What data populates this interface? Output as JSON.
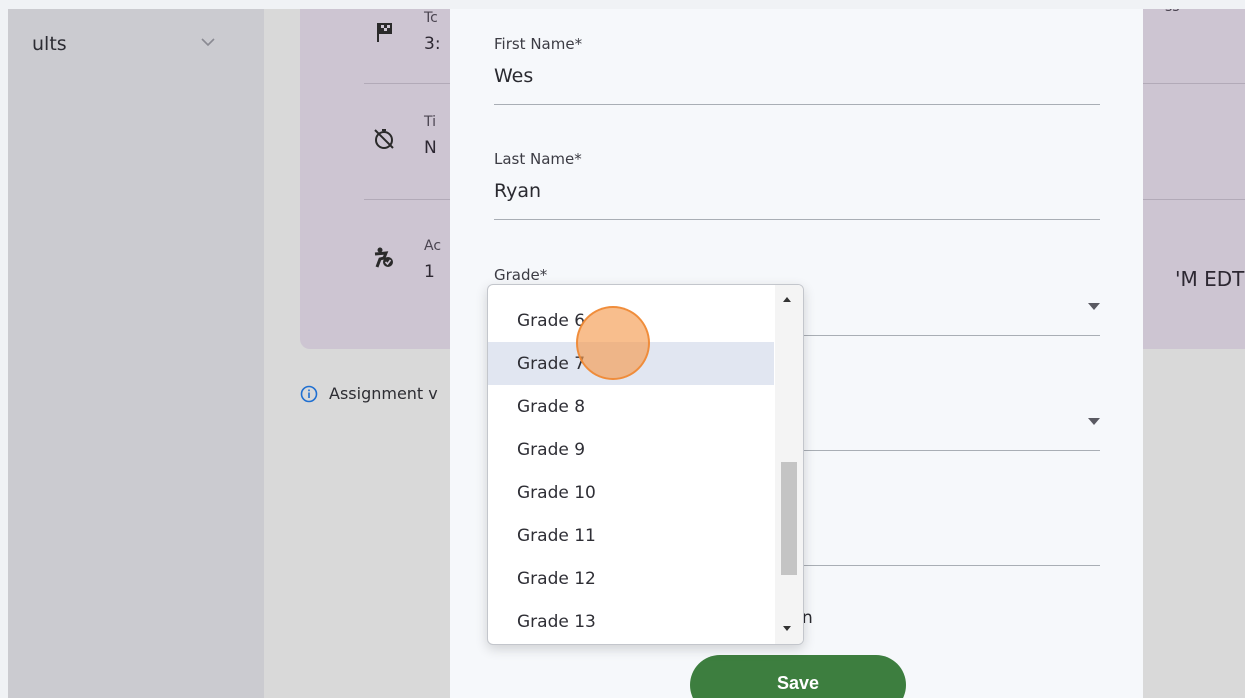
{
  "sidebar": {
    "item_label": "ults",
    "chevron_icon": "chevron-down-icon"
  },
  "background": {
    "rows": [
      {
        "icon": "checkered-flag-icon",
        "t1": "Tc",
        "t2": "3:"
      },
      {
        "icon": "timer-off-icon",
        "t1": "Ti",
        "t2": "N"
      },
      {
        "icon": "accessibility-icon",
        "t1": "Ac",
        "t2": "1"
      }
    ],
    "right_caption": "ss",
    "right_time": "'M EDT",
    "assignment_note": "Assignment v",
    "behind_text": "n"
  },
  "form": {
    "first_name": {
      "label": "First Name*",
      "value": "Wes"
    },
    "last_name": {
      "label": "Last Name*",
      "value": "Ryan"
    },
    "grade": {
      "label": "Grade*",
      "options": [
        "Grade 6",
        "Grade 7",
        "Grade 8",
        "Grade 9",
        "Grade 10",
        "Grade 11",
        "Grade 12",
        "Grade 13"
      ],
      "highlighted": "Grade 7"
    },
    "save_label": "Save"
  },
  "colors": {
    "save_button": "#3d7e3f",
    "highlight": "#e1e6f1",
    "card": "#cdc5d2",
    "cursor": "#f59b50"
  }
}
